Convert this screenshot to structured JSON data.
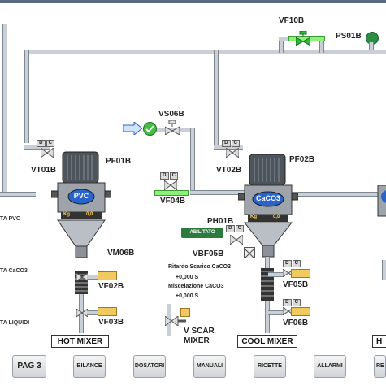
{
  "valves": {
    "vf10b": "VF10B",
    "ps01b": "PS01B",
    "vs06b": "VS06B",
    "vt01b": "VT01B",
    "vt02b": "VT02B",
    "vf04b": "VF04B",
    "pf01b": "PF01B",
    "pf02b": "PF02B",
    "ph01b": "PH01B",
    "vbf05b": "VBF05B",
    "vm06b": "VM06B",
    "vf02b": "VF02B",
    "vf03b": "VF03B",
    "vf05b": "VF05B",
    "vf06b": "VF06B",
    "v_scar": "V SCAR",
    "mixer": "MIXER"
  },
  "hoppers": {
    "left_label": "PVC",
    "right_label": "CaCO3",
    "kg_unit": "Kg",
    "left_value": "0,0",
    "right_value": "0,0"
  },
  "side_labels": {
    "pvc": "TA PVC",
    "caco3": "TA CaCO3",
    "liquidi": "TA LIQUIDI"
  },
  "info": {
    "abilitato": "ABILITATO",
    "ritardo_label": "Ritardo Scarico CaCO3",
    "ritardo_value": "+0,000 S",
    "misc_label": "Miscelazione CaCO3",
    "misc_value": "+0,000 S"
  },
  "minibox": {
    "a": "D",
    "b": "C"
  },
  "mixers": {
    "hot": "HOT MIXER",
    "cool": "COOL MIXER",
    "right_partial": "H"
  },
  "nav": {
    "pag3": "PAG 3",
    "bilance": "BILANCE",
    "dosatori": "DOSATORI",
    "manuali": "MANUALI",
    "ricette": "RICETTE",
    "allarmi": "ALLARMI",
    "partial": "RE"
  },
  "colors": {
    "pipe": "#c9cfd6",
    "active_pipe": "#8df07a",
    "valve_green": "#2fb83a",
    "hopper_dark": "#555b62",
    "label_blue": "#2a64c8"
  }
}
